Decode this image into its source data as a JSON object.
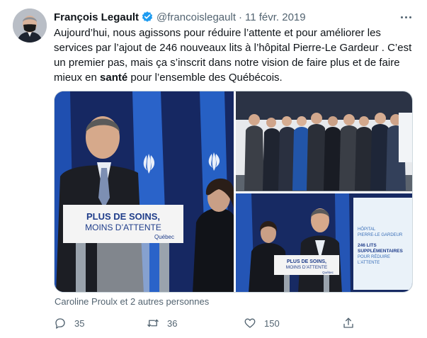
{
  "tweet": {
    "display_name": "François Legault",
    "handle": "@francoislegault",
    "separator": "·",
    "date": "11 févr. 2019",
    "text_part1": "Aujourd’hui, nous agissons pour réduire l’attente et pour améliorer les services par l’ajout de 246 nouveaux lits à l’hôpital Pierre-Le Gardeur . C’est un premier pas, mais ça s’inscrit dans notre vision de faire plus et de faire mieux en ",
    "text_bold": "santé",
    "text_part2": " pour l’ensemble des Québécois.",
    "tagged_people": "Caroline Proulx et 2 autres personnes"
  },
  "photos": {
    "photo1": {
      "podium_line1": "PLUS DE SOINS,",
      "podium_line2": "MOINS D’ATTENTE",
      "podium_logo": "Québec"
    },
    "photo3": {
      "podium_line1": "PLUS DE SOINS,",
      "podium_line2": "MOINS D’ATTENTE",
      "podium_logo": "Québec",
      "screen_line1": "HÔPITAL",
      "screen_line2": "PIERRE-LE GARDEUR",
      "screen_line3": "246 LITS",
      "screen_line4": "SUPPLÉMENTAIRES",
      "screen_line5": "POUR RÉDUIRE",
      "screen_line6": "L’ATTENTE"
    }
  },
  "actions": {
    "replies": "35",
    "retweets": "36",
    "likes": "150"
  },
  "icons": {
    "verified": "verified-badge-icon",
    "more": "more-options-icon",
    "reply": "reply-icon",
    "retweet": "retweet-icon",
    "like": "like-heart-icon",
    "share": "share-icon"
  },
  "colors": {
    "text": "#0f1419",
    "secondary": "#536471",
    "verified": "#1d9bf0",
    "border": "#cfd9de"
  }
}
